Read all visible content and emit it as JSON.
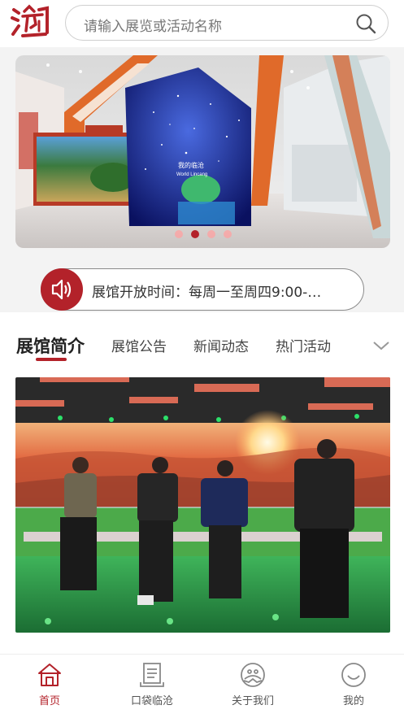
{
  "colors": {
    "accent": "#b3222a",
    "background": "#f3f3f3"
  },
  "header": {
    "logo_icon": "calligraphy-seal-logo",
    "search": {
      "placeholder": "请输入展览或活动名称",
      "icon": "search-icon"
    }
  },
  "banner": {
    "slides": 4,
    "active_slide": 2,
    "sign_text": "我的临沧",
    "sign_text_en": "World Lincang"
  },
  "notice": {
    "icon": "speaker-icon",
    "text": "展馆开放时间：每周一至周四9:00-…"
  },
  "tabs": [
    {
      "label": "展馆简介",
      "active": true
    },
    {
      "label": "展馆公告",
      "active": false
    },
    {
      "label": "新闻动态",
      "active": false
    },
    {
      "label": "热门活动",
      "active": false
    }
  ],
  "tabs_more_icon": "chevron-down-icon",
  "bottom_nav": [
    {
      "label": "首页",
      "icon": "home-icon",
      "active": true
    },
    {
      "label": "口袋临沧",
      "icon": "book-icon",
      "active": false
    },
    {
      "label": "关于我们",
      "icon": "about-icon",
      "active": false
    },
    {
      "label": "我的",
      "icon": "smile-icon",
      "active": false
    }
  ]
}
